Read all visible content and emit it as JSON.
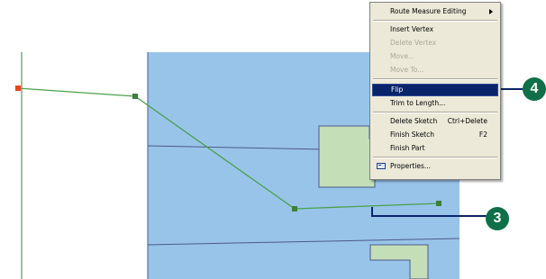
{
  "context_menu": {
    "items": [
      {
        "label": "Route Measure Editing",
        "shortcut": "",
        "enabled": true,
        "selected": false,
        "submenu": true,
        "icon": ""
      },
      {
        "label": "Insert Vertex",
        "shortcut": "",
        "enabled": true,
        "selected": false,
        "submenu": false,
        "icon": ""
      },
      {
        "label": "Delete Vertex",
        "shortcut": "",
        "enabled": false,
        "selected": false,
        "submenu": false,
        "icon": ""
      },
      {
        "label": "Move...",
        "shortcut": "",
        "enabled": false,
        "selected": false,
        "submenu": false,
        "icon": ""
      },
      {
        "label": "Move To...",
        "shortcut": "",
        "enabled": false,
        "selected": false,
        "submenu": false,
        "icon": ""
      },
      {
        "label": "Flip",
        "shortcut": "",
        "enabled": true,
        "selected": true,
        "submenu": false,
        "icon": ""
      },
      {
        "label": "Trim to Length...",
        "shortcut": "",
        "enabled": true,
        "selected": false,
        "submenu": false,
        "icon": ""
      },
      {
        "label": "Delete Sketch",
        "shortcut": "Ctrl+Delete",
        "enabled": true,
        "selected": false,
        "submenu": false,
        "icon": ""
      },
      {
        "label": "Finish Sketch",
        "shortcut": "F2",
        "enabled": true,
        "selected": false,
        "submenu": false,
        "icon": ""
      },
      {
        "label": "Finish Part",
        "shortcut": "",
        "enabled": true,
        "selected": false,
        "submenu": false,
        "icon": ""
      },
      {
        "label": "Properties...",
        "shortcut": "",
        "enabled": true,
        "selected": false,
        "submenu": false,
        "icon": "properties-icon"
      }
    ]
  },
  "callouts": {
    "step3": "3",
    "step4": "4"
  },
  "colors": {
    "map_water": "#99c4ea",
    "parcel_fill": "#c4dfb8",
    "sketch_line": "#4aa14a",
    "vertex": "#3d7f3d",
    "start_vertex": "#e8461e",
    "menu_bg": "#ece9d8",
    "menu_highlight": "#0a246a",
    "callout": "#0f6f48"
  }
}
